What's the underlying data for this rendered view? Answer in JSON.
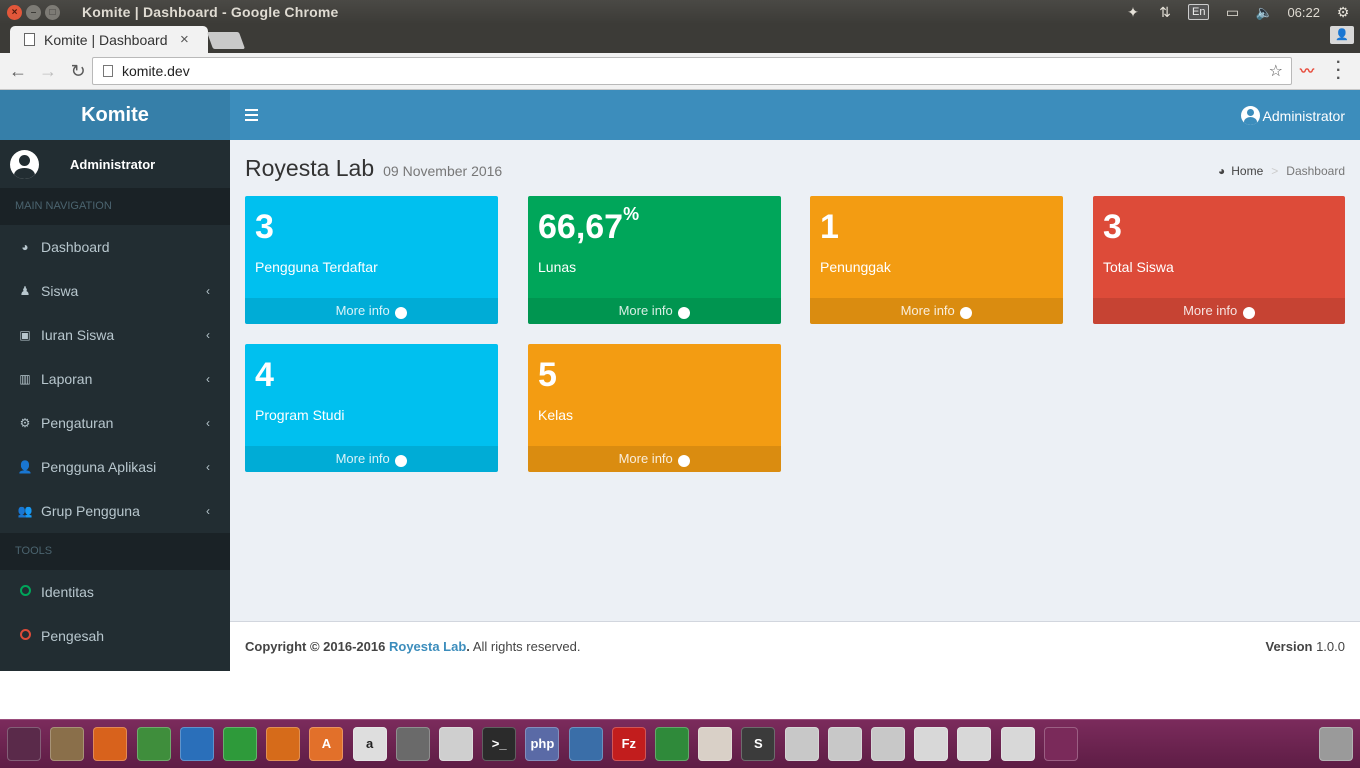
{
  "os": {
    "window_title": "Komite | Dashboard - Google Chrome",
    "win_close": "×",
    "win_min": "–",
    "win_max": "□",
    "lang": "En",
    "time": "06:22"
  },
  "browser": {
    "tab_title": "Komite | Dashboard",
    "tab_close": "×",
    "url": "komite.dev"
  },
  "sidebar": {
    "logo": "Komite",
    "user": "Administrator",
    "sections": [
      {
        "header": "MAIN NAVIGATION",
        "items": [
          {
            "label": "Dashboard"
          },
          {
            "label": "Siswa"
          },
          {
            "label": "Iuran Siswa"
          },
          {
            "label": "Laporan"
          },
          {
            "label": "Pengaturan"
          },
          {
            "label": "Pengguna Aplikasi"
          },
          {
            "label": "Grup Pengguna"
          }
        ]
      },
      {
        "header": "TOOLS",
        "items": [
          {
            "label": "Identitas",
            "color": "#00a65a"
          },
          {
            "label": "Pengesah",
            "color": "#dd4b39"
          }
        ]
      }
    ]
  },
  "topbar": {
    "user": "Administrator"
  },
  "content": {
    "title": "Royesta Lab",
    "date": "09 November 2016",
    "breadcrumb": {
      "home": "Home",
      "current": "Dashboard"
    },
    "boxes": [
      {
        "value": "3",
        "label": "Pengguna Terdaftar",
        "more": "More info",
        "color": "#00c0ef"
      },
      {
        "value": "66,67",
        "suffix": "%",
        "label": "Lunas",
        "more": "More info",
        "color": "#00a65a"
      },
      {
        "value": "1",
        "label": "Penunggak",
        "more": "More info",
        "color": "#f39c12"
      },
      {
        "value": "3",
        "label": "Total Siswa",
        "more": "More info",
        "color": "#dd4b39"
      },
      {
        "value": "4",
        "label": "Program Studi",
        "more": "More info",
        "color": "#00c0ef"
      },
      {
        "value": "5",
        "label": "Kelas",
        "more": "More info",
        "color": "#f39c12"
      }
    ]
  },
  "footer": {
    "copyright_prefix": "Copyright © 2016-2016",
    "org": "Royesta Lab",
    "suffix": "All rights reserved.",
    "version_label": "Version",
    "version": "1.0.0"
  },
  "dock": {
    "apps": [
      {
        "name": "ubuntu-logo-icon",
        "color": "#5a2a4a"
      },
      {
        "name": "files-icon",
        "color": "#8a6f4a"
      },
      {
        "name": "firefox-icon",
        "color": "#d8621c"
      },
      {
        "name": "chrome-icon",
        "color": "#3f8e3c"
      },
      {
        "name": "writer-icon",
        "color": "#2a6fba"
      },
      {
        "name": "calc-icon",
        "color": "#2e9a3a"
      },
      {
        "name": "impress-icon",
        "color": "#d66b1a"
      },
      {
        "name": "software-center-icon",
        "color": "#e2702a",
        "text": "A"
      },
      {
        "name": "amazon-icon",
        "color": "#dedede",
        "text": "a"
      },
      {
        "name": "calculator-icon",
        "color": "#6a6a6a"
      },
      {
        "name": "text-editor-icon",
        "color": "#cfcfcf"
      },
      {
        "name": "terminal-icon",
        "color": "#2b2b2b",
        "text": ">_"
      },
      {
        "name": "php-icon",
        "color": "#5a6aa6",
        "text": "php"
      },
      {
        "name": "virtualbox-icon",
        "color": "#3a6ea8"
      },
      {
        "name": "filezilla-icon",
        "color": "#c21d1d",
        "text": "Fz"
      },
      {
        "name": "download-manager-icon",
        "color": "#2f8a3a"
      },
      {
        "name": "mixer-icon",
        "color": "#d9d0c7"
      },
      {
        "name": "sublime-icon",
        "color": "#3b3b3b",
        "text": "S"
      },
      {
        "name": "drive-icon",
        "color": "#c8c8c8"
      },
      {
        "name": "drive-icon",
        "color": "#c8c8c8"
      },
      {
        "name": "drive-icon",
        "color": "#c8c8c8"
      },
      {
        "name": "usb-drive-icon",
        "color": "#d8d8d8"
      },
      {
        "name": "usb-drive-icon",
        "color": "#d8d8d8"
      },
      {
        "name": "usb-drive-icon",
        "color": "#d8d8d8"
      },
      {
        "name": "workspace-switcher-icon",
        "color": "#7a2a5a"
      },
      {
        "name": "trash-icon",
        "color": "#9a9a9a"
      }
    ]
  }
}
